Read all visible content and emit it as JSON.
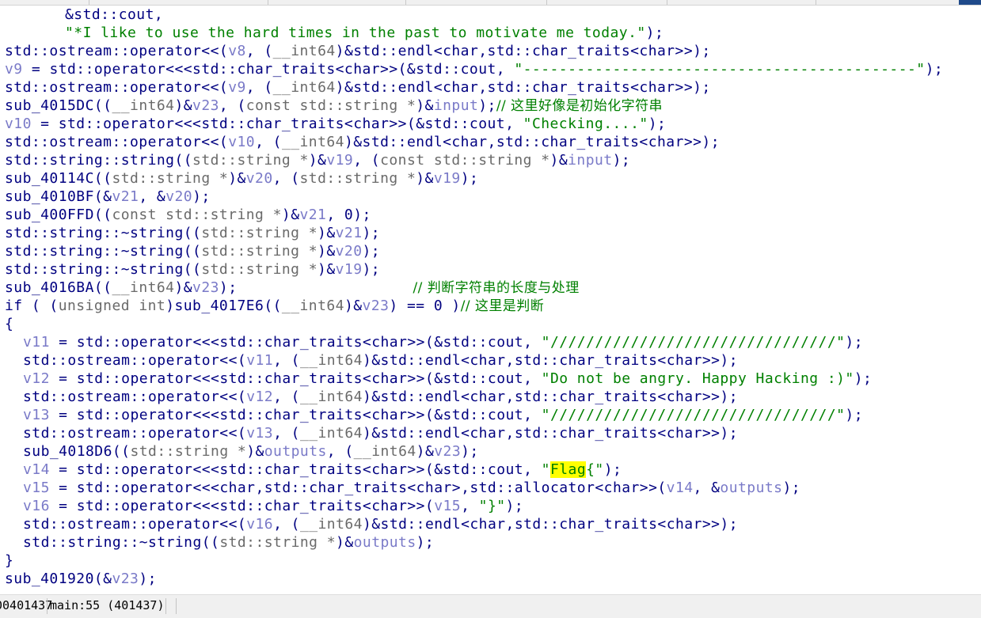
{
  "status": {
    "address": "00401437",
    "location": "main:55 (401437)"
  },
  "code": {
    "l1": "&std::cout,",
    "l2_str": "\"*I like to use the hard times in the past to motivate me today.\"",
    "l2_end": ");",
    "l3a": "std::ostream::operator<<(",
    "l3v": "v8",
    "l3b": ", (",
    "l3c": "__int64",
    "l3d": ")&std::endl<char,std::char_traits<char>>);",
    "l4v": "v9",
    "l4a": " = std::operator<<<std::char_traits<char>>(&std::cout, ",
    "l4s": "\"--------------------------------------------\"",
    "l4b": ");",
    "l5a": "std::ostream::operator<<(",
    "l5v": "v9",
    "l5b": ", (",
    "l5c": "__int64",
    "l5d": ")&std::endl<char,std::char_traits<char>>);",
    "l6a": "sub_4015DC((",
    "l6b": "__int64",
    "l6c": ")&",
    "l6v": "v23",
    "l6d": ", (",
    "l6e": "const std::string *",
    "l6f": ")&",
    "l6g": "input",
    "l6h": ");",
    "l6cm": "// 这里好像是初始化字符串",
    "l7v": "v10",
    "l7a": " = std::operator<<<std::char_traits<char>>(&std::cout, ",
    "l7s": "\"Checking....\"",
    "l7b": ");",
    "l8a": "std::ostream::operator<<(",
    "l8v": "v10",
    "l8b": ", (",
    "l8c": "__int64",
    "l8d": ")&std::endl<char,std::char_traits<char>>);",
    "l9a": "std::string::string((",
    "l9b": "std::string *",
    "l9c": ")&",
    "l9v": "v19",
    "l9d": ", (",
    "l9e": "const std::string *",
    "l9f": ")&",
    "l9g": "input",
    "l9h": ");",
    "l10a": "sub_40114C((",
    "l10b": "std::string *",
    "l10c": ")&",
    "l10v": "v20",
    "l10d": ", (",
    "l10e": "std::string *",
    "l10f": ")&",
    "l10g": "v19",
    "l10h": ");",
    "l11a": "sub_4010BF(&",
    "l11v": "v21",
    "l11b": ", &",
    "l11g": "v20",
    "l11c": ");",
    "l12a": "sub_400FFD((",
    "l12b": "const std::string *",
    "l12c": ")&",
    "l12v": "v21",
    "l12d": ", 0);",
    "l13a": "std::string::~string((",
    "l13b": "std::string *",
    "l13c": ")&",
    "l13v": "v21",
    "l13d": ");",
    "l14a": "std::string::~string((",
    "l14b": "std::string *",
    "l14c": ")&",
    "l14v": "v20",
    "l14d": ");",
    "l15a": "std::string::~string((",
    "l15b": "std::string *",
    "l15c": ")&",
    "l15v": "v19",
    "l15d": ");",
    "l16a": "sub_4016BA((",
    "l16b": "__int64",
    "l16c": ")&",
    "l16v": "v23",
    "l16d": ");",
    "l16cm": "// 判断字符串的长度与处理",
    "l17a": "if ( (",
    "l17b": "unsigned int",
    "l17c": ")sub_4017E6((",
    "l17d": "__int64",
    "l17e": ")&",
    "l17v": "v23",
    "l17f": ") == 0 )",
    "l17cm": "// 这里是判断",
    "l18": "{",
    "l19v": "v11",
    "l19a": " = std::operator<<<std::char_traits<char>>(&std::cout, ",
    "l19s": "\"////////////////////////////////\"",
    "l19b": ");",
    "l20a": "std::ostream::operator<<(",
    "l20v": "v11",
    "l20b": ", (",
    "l20c": "__int64",
    "l20d": ")&std::endl<char,std::char_traits<char>>);",
    "l21v": "v12",
    "l21a": " = std::operator<<<std::char_traits<char>>(&std::cout, ",
    "l21s": "\"Do not be angry. Happy Hacking :)\"",
    "l21b": ");",
    "l22a": "std::ostream::operator<<(",
    "l22v": "v12",
    "l22b": ", (",
    "l22c": "__int64",
    "l22d": ")&std::endl<char,std::char_traits<char>>);",
    "l23v": "v13",
    "l23a": " = std::operator<<<std::char_traits<char>>(&std::cout, ",
    "l23s": "\"////////////////////////////////\"",
    "l23b": ");",
    "l24a": "std::ostream::operator<<(",
    "l24v": "v13",
    "l24b": ", (",
    "l24c": "__int64",
    "l24d": ")&std::endl<char,std::char_traits<char>>);",
    "l25a": "sub_4018D6((",
    "l25b": "std::string *",
    "l25c": ")&",
    "l25v": "outputs",
    "l25d": ", (",
    "l25e": "__int64",
    "l25f": ")&",
    "l25g": "v23",
    "l25h": ");",
    "l26v": "v14",
    "l26a": " = std::operator<<<std::char_traits<char>>(&std::cout, ",
    "l26q": "\"",
    "l26hl": "Flag",
    "l26s": "{\"",
    "l26b": ");",
    "l27v": "v15",
    "l27a": " = std::operator<<<char,std::char_traits<char>,std::allocator<char>>(",
    "l27g": "v14",
    "l27b": ", &",
    "l27h": "outputs",
    "l27c": ");",
    "l28v": "v16",
    "l28a": " = std::operator<<<std::char_traits<char>>(",
    "l28g": "v15",
    "l28b": ", ",
    "l28s": "\"}\"",
    "l28c": ");",
    "l29a": "std::ostream::operator<<(",
    "l29v": "v16",
    "l29b": ", (",
    "l29c": "__int64",
    "l29d": ")&std::endl<char,std::char_traits<char>>);",
    "l30a": "std::string::~string((",
    "l30b": "std::string *",
    "l30c": ")&",
    "l30v": "outputs",
    "l30d": ");",
    "l31": "}",
    "l32a": "sub_401920(&",
    "l32v": "v23",
    "l32b": ");"
  }
}
